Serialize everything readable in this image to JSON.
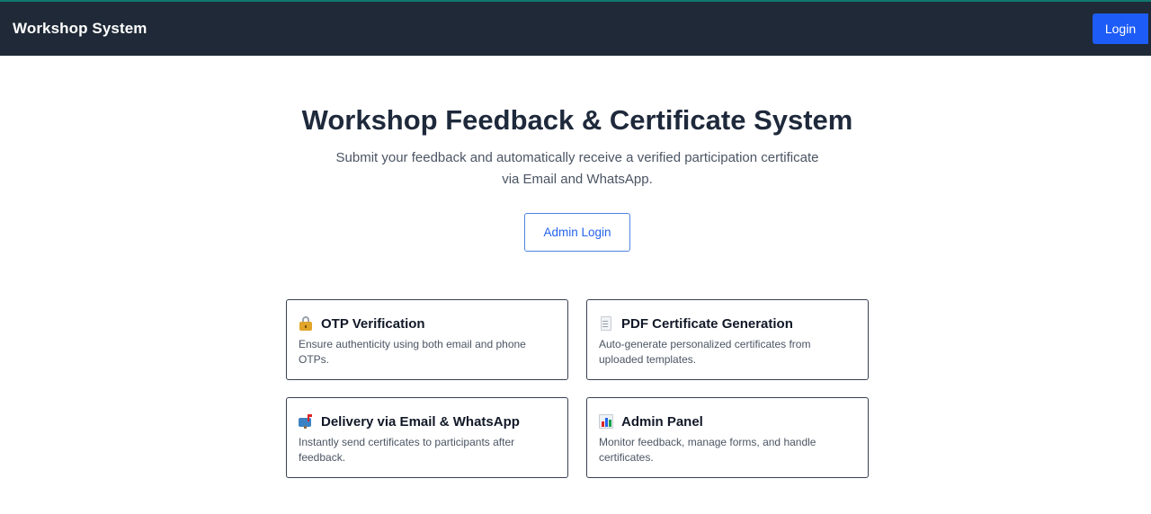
{
  "navbar": {
    "brand": "Workshop System",
    "login_label": "Login"
  },
  "hero": {
    "title": "Workshop Feedback & Certificate System",
    "subtitle": "Submit your feedback and automatically receive a verified participation certificate via Email and WhatsApp.",
    "admin_button": "Admin Login"
  },
  "features": [
    {
      "icon": "lock-icon",
      "title": "OTP Verification",
      "description": "Ensure authenticity using both email and phone OTPs."
    },
    {
      "icon": "document-icon",
      "title": "PDF Certificate Generation",
      "description": "Auto-generate personalized certificates from uploaded templates."
    },
    {
      "icon": "mailbox-icon",
      "title": "Delivery via Email & WhatsApp",
      "description": "Instantly send certificates to participants after feedback."
    },
    {
      "icon": "bar-chart-icon",
      "title": "Admin Panel",
      "description": "Monitor feedback, manage forms, and handle certificates."
    }
  ],
  "colors": {
    "navbar_bg": "#1f2937",
    "primary": "#1d5cf6",
    "text_dark": "#1e293b"
  }
}
